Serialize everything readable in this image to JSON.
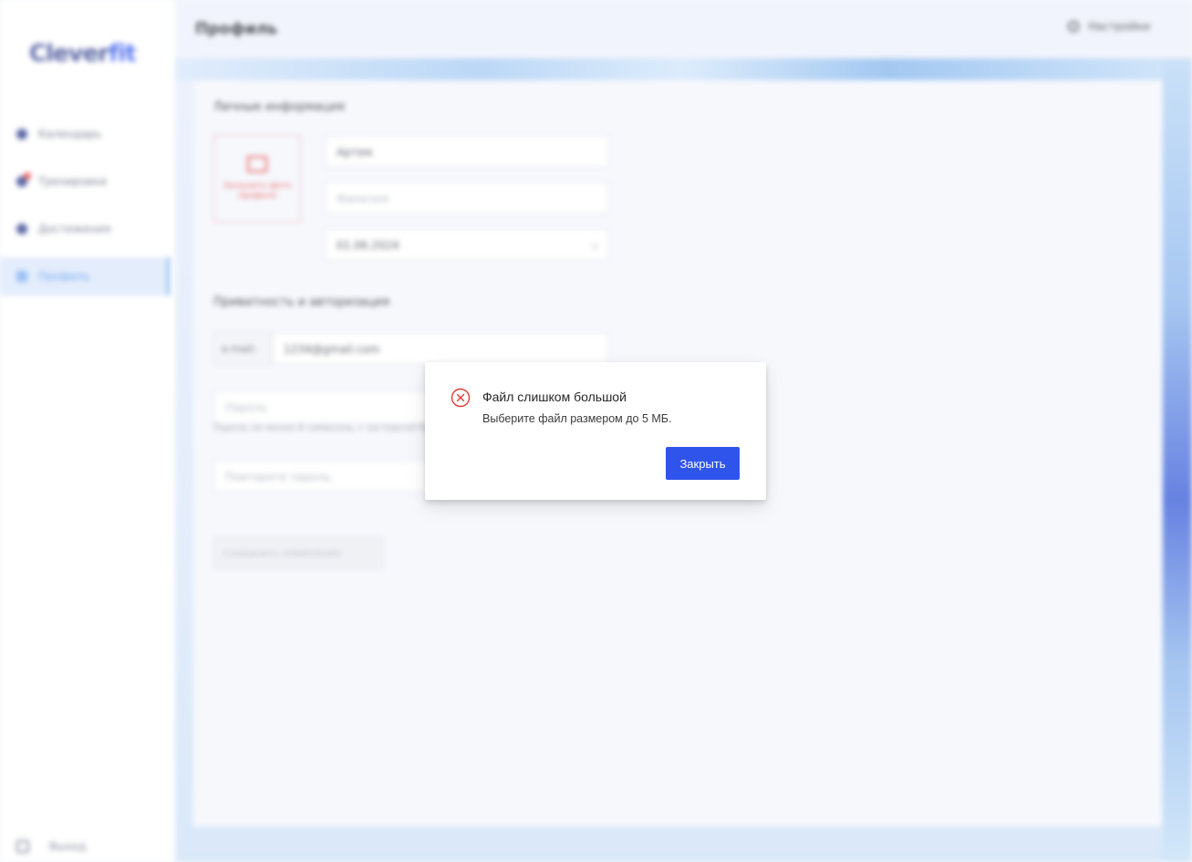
{
  "app": {
    "logo_part1": "Clever",
    "logo_part2": "fit"
  },
  "sidebar": {
    "items": [
      {
        "label": "Календарь",
        "icon": "calendar-icon"
      },
      {
        "label": "Тренировки",
        "icon": "heart-icon"
      },
      {
        "label": "Достижения",
        "icon": "trophy-icon"
      },
      {
        "label": "Профиль",
        "icon": "profile-icon"
      }
    ],
    "logout_label": "Выход"
  },
  "header": {
    "title": "Профиль",
    "settings_label": "Настройки"
  },
  "profile": {
    "personal_title": "Личные информация",
    "avatar_upload_label": "Загрузить фото профиля",
    "first_name": "Артем",
    "last_name_placeholder": "Фамилия",
    "birth_date": "01.06.2024",
    "auth_title": "Приватность и авторизация",
    "email_addon": "e-mail:",
    "email": "1234@gmail.com",
    "password_placeholder": "Пароль",
    "password_hint": "Пароль не менее 8 символов, с заглавной буквой и цифрой",
    "repeat_password_placeholder": "Повторите пароль",
    "save_label": "Сохранить изменения"
  },
  "modal": {
    "title": "Файл слишком большой",
    "text": "Выберите файл размером до 5 МБ.",
    "close_label": "Закрыть",
    "icon": "error-circle-icon",
    "accent": "#2f54eb",
    "error_color": "#e53935"
  }
}
